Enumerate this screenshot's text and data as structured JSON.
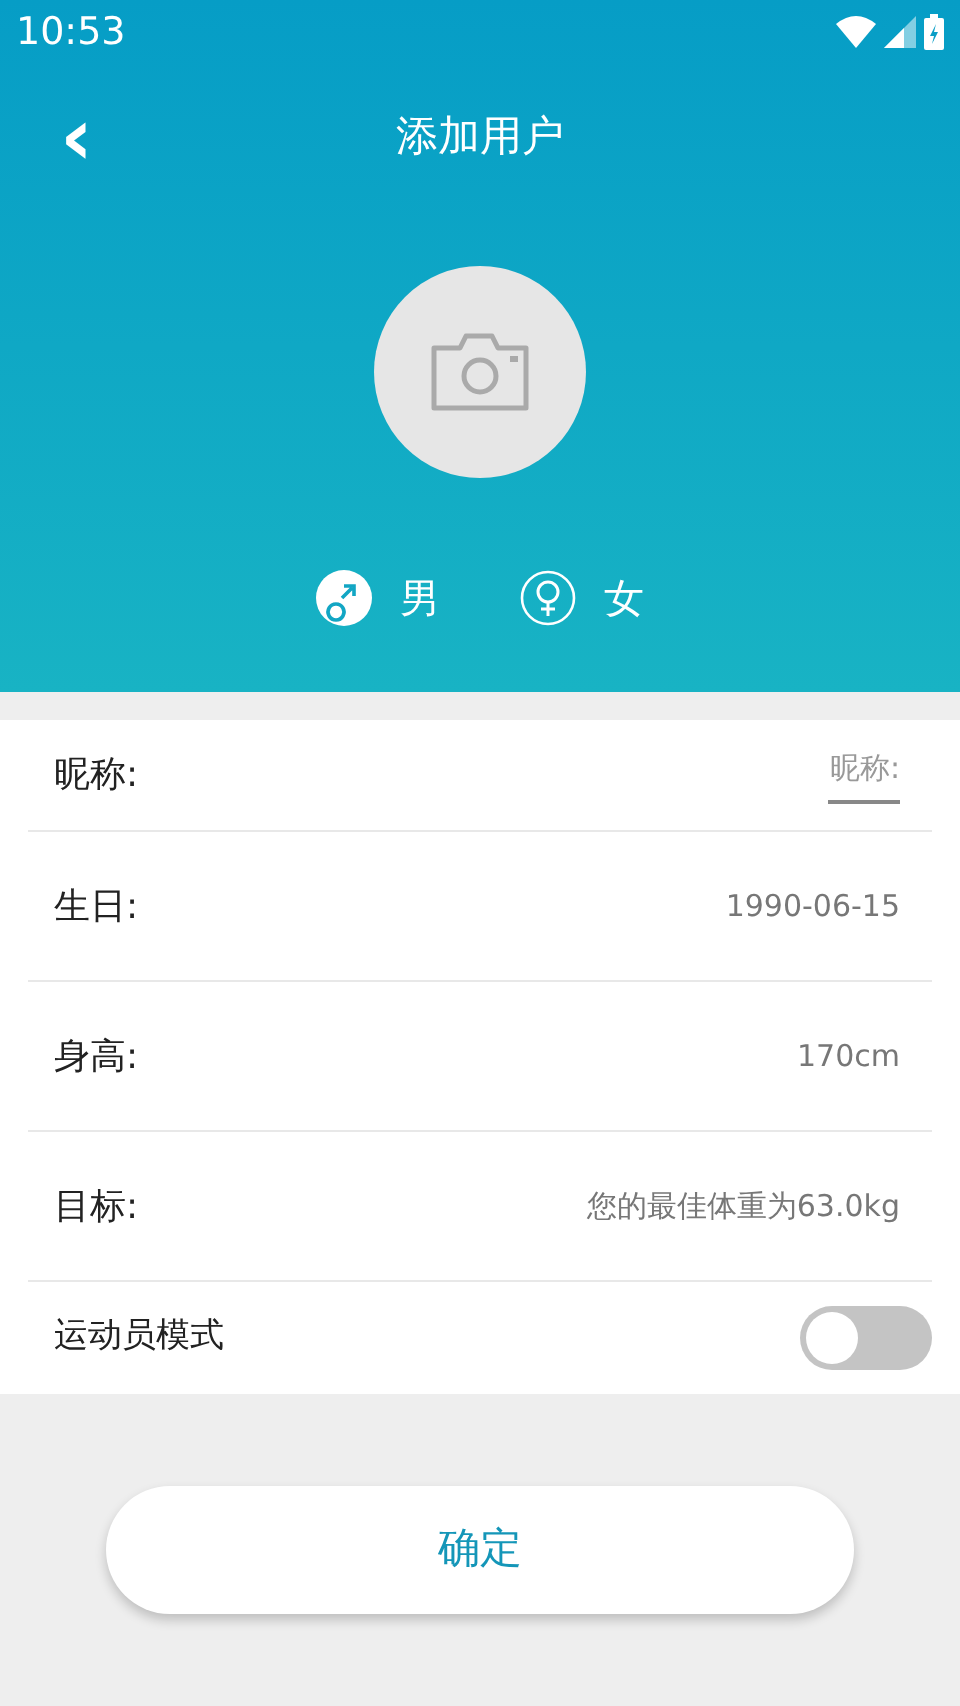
{
  "status_bar": {
    "time": "10:53"
  },
  "header": {
    "back": "‹",
    "title": "添加用户"
  },
  "genders": [
    {
      "label": "男",
      "kind": "male",
      "selected": true
    },
    {
      "label": "女",
      "kind": "female",
      "selected": false
    }
  ],
  "fields": [
    {
      "kind": "input",
      "label": "昵称:",
      "placeholder": "昵称:"
    },
    {
      "kind": "value",
      "label": "生日:",
      "value": "1990-06-15"
    },
    {
      "kind": "value",
      "label": "身高:",
      "value": "170cm"
    },
    {
      "kind": "value",
      "label": "目标:",
      "value": "您的最佳体重为63.0kg"
    },
    {
      "kind": "toggle",
      "label": "运动员模式",
      "on": false
    }
  ],
  "confirm_button": "确定"
}
